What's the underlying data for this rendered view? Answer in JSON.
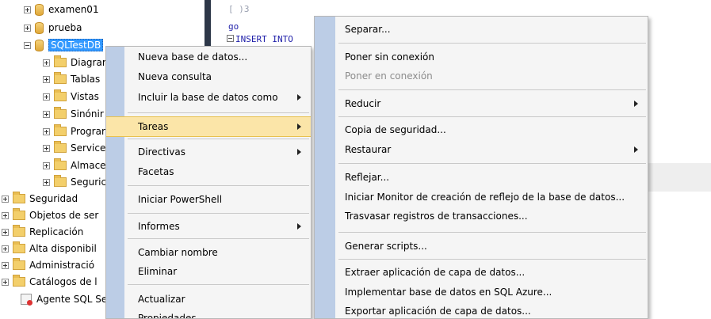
{
  "tree": {
    "items": [
      {
        "label": "examen01",
        "expander": "plus",
        "icon": "database-icon"
      },
      {
        "label": "prueba",
        "expander": "plus",
        "icon": "database-icon"
      },
      {
        "label": "SQLTestDB",
        "expander": "minus",
        "icon": "database-icon",
        "selected": true
      },
      {
        "label": "Diagrar",
        "expander": "plus",
        "icon": "folder-icon"
      },
      {
        "label": "Tablas",
        "expander": "plus",
        "icon": "folder-icon"
      },
      {
        "label": "Vistas",
        "expander": "plus",
        "icon": "folder-icon"
      },
      {
        "label": "Sinónir",
        "expander": "plus",
        "icon": "folder-icon"
      },
      {
        "label": "Prograr",
        "expander": "plus",
        "icon": "folder-icon"
      },
      {
        "label": "Service",
        "expander": "plus",
        "icon": "folder-icon"
      },
      {
        "label": "Almace",
        "expander": "plus",
        "icon": "folder-icon"
      },
      {
        "label": "Seguric",
        "expander": "plus",
        "icon": "folder-icon"
      },
      {
        "label": "Seguridad",
        "expander": "plus",
        "icon": "folder-icon"
      },
      {
        "label": "Objetos de ser",
        "expander": "plus",
        "icon": "folder-icon"
      },
      {
        "label": "Replicación",
        "expander": "plus",
        "icon": "folder-icon"
      },
      {
        "label": "Alta disponibil",
        "expander": "plus",
        "icon": "folder-icon"
      },
      {
        "label": "Administració",
        "expander": "plus",
        "icon": "folder-icon"
      },
      {
        "label": "Catálogos de l",
        "expander": "plus",
        "icon": "folder-icon"
      },
      {
        "label": "Agente SQL Se",
        "expander": "none",
        "icon": "sql-agent-icon"
      }
    ]
  },
  "editor": {
    "lines": [
      "[ )3",
      "go",
      "INSERT INTO"
    ]
  },
  "context_menu": {
    "items": [
      {
        "label": "Nueva base de datos...",
        "submenu": false
      },
      {
        "label": "Nueva consulta",
        "submenu": false
      },
      {
        "label": "Incluir la base de datos como",
        "submenu": true
      },
      {
        "label": "Tareas",
        "submenu": true,
        "highlighted": true
      },
      {
        "label": "Directivas",
        "submenu": true
      },
      {
        "label": "Facetas",
        "submenu": false
      },
      {
        "label": "Iniciar PowerShell",
        "submenu": false
      },
      {
        "label": "Informes",
        "submenu": true
      },
      {
        "label": "Cambiar nombre",
        "submenu": false
      },
      {
        "label": "Eliminar",
        "submenu": false
      },
      {
        "label": "Actualizar",
        "submenu": false
      },
      {
        "label": "Propiedades",
        "submenu": false
      }
    ]
  },
  "tasks_submenu": {
    "items": [
      {
        "label": "Separar...",
        "submenu": false
      },
      {
        "label": "Poner sin conexión",
        "submenu": false
      },
      {
        "label": "Poner en conexión",
        "submenu": false,
        "disabled": true
      },
      {
        "label": "Reducir",
        "submenu": true
      },
      {
        "label": "Copia de seguridad...",
        "submenu": false
      },
      {
        "label": "Restaurar",
        "submenu": true
      },
      {
        "label": "Reflejar...",
        "submenu": false
      },
      {
        "label": "Iniciar Monitor de creación de reflejo de la base de datos...",
        "submenu": false
      },
      {
        "label": "Trasvasar registros de transacciones...",
        "submenu": false
      },
      {
        "label": "Generar scripts...",
        "submenu": false
      },
      {
        "label": "Extraer aplicación de capa de datos...",
        "submenu": false
      },
      {
        "label": "Implementar base de datos en SQL Azure...",
        "submenu": false
      },
      {
        "label": "Exportar aplicación de capa de datos...",
        "submenu": false
      }
    ]
  },
  "colors": {
    "menu_background": "#f5f5f5",
    "menu_gutter": "#bccde6",
    "menu_highlight": "#fbe5a8",
    "tree_selection": "#3399ff",
    "editor_bar": "#2d3748",
    "code_keyword": "#1e1ea8"
  }
}
